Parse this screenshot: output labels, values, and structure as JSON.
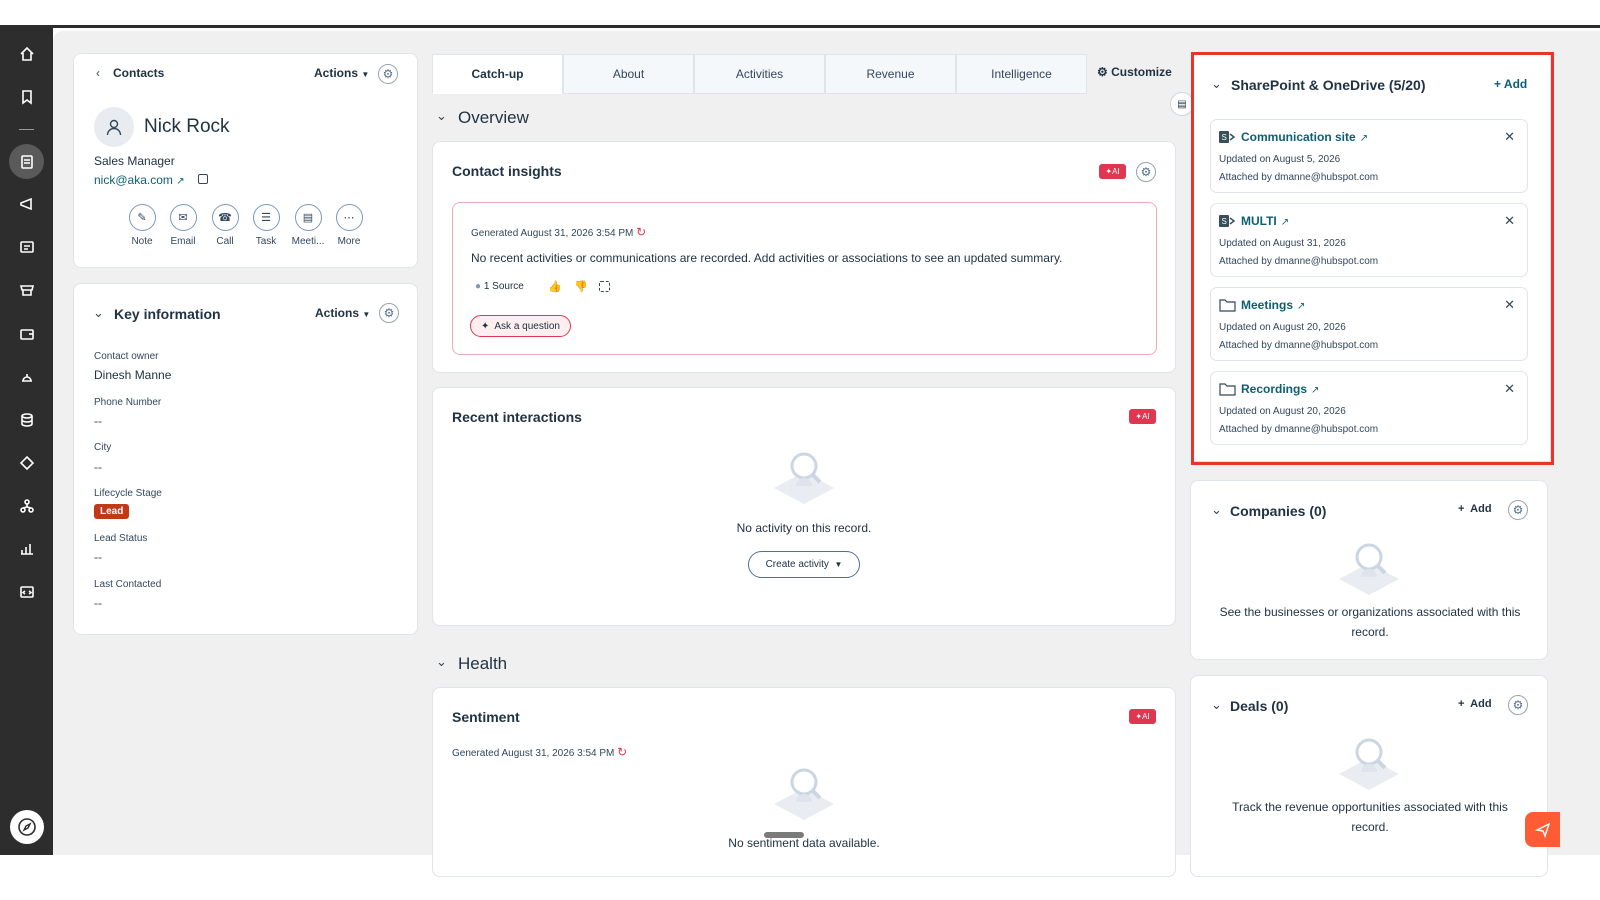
{
  "contact": {
    "back_label": "Contacts",
    "actions_label": "Actions",
    "name": "Nick Rock",
    "job_title": "Sales Manager",
    "email": "nick@aka.com",
    "actions": [
      {
        "label": "Note",
        "icon": "note-icon"
      },
      {
        "label": "Email",
        "icon": "email-icon"
      },
      {
        "label": "Call",
        "icon": "call-icon"
      },
      {
        "label": "Task",
        "icon": "task-icon"
      },
      {
        "label": "Meeti...",
        "icon": "meeting-icon"
      },
      {
        "label": "More",
        "icon": "more-icon"
      }
    ]
  },
  "key_info": {
    "title": "Key information",
    "actions_label": "Actions",
    "fields": [
      {
        "label": "Contact owner",
        "value": "Dinesh Manne"
      },
      {
        "label": "Phone Number",
        "value": "--"
      },
      {
        "label": "City",
        "value": "--"
      },
      {
        "label": "Lifecycle Stage",
        "value": "Lead"
      },
      {
        "label": "Lead Status",
        "value": "--"
      },
      {
        "label": "Last Contacted",
        "value": "--"
      }
    ]
  },
  "tabs": [
    "Catch-up",
    "About",
    "Activities",
    "Revenue",
    "Intelligence"
  ],
  "customize_label": "Customize",
  "overview": {
    "title": "Overview",
    "insights": {
      "title": "Contact insights",
      "ai_badge": "AI",
      "generated": "Generated August 31, 2026 3:54 PM",
      "summary": "No recent activities or communications are recorded. Add activities or associations to see an updated summary.",
      "sources": "1 Source",
      "ask_label": "Ask a question"
    },
    "recent": {
      "title": "Recent interactions",
      "ai_badge": "AI",
      "empty": "No activity on this record.",
      "create_label": "Create activity"
    }
  },
  "health": {
    "title": "Health",
    "sentiment": {
      "title": "Sentiment",
      "ai_badge": "AI",
      "generated": "Generated August 31, 2026 3:54 PM",
      "empty": "No sentiment data available."
    }
  },
  "sharepoint": {
    "title": "SharePoint & OneDrive (5/20)",
    "add_label": "+ Add",
    "items": [
      {
        "name": "Communication site",
        "updated": "Updated on August 5, 2026",
        "attached": "Attached by dmanne@hubspot.com",
        "type": "sharepoint"
      },
      {
        "name": "MULTI",
        "updated": "Updated on August 31, 2026",
        "attached": "Attached by dmanne@hubspot.com",
        "type": "sharepoint"
      },
      {
        "name": "Meetings",
        "updated": "Updated on August 20, 2026",
        "attached": "Attached by dmanne@hubspot.com",
        "type": "folder"
      },
      {
        "name": "Recordings",
        "updated": "Updated on August 20, 2026",
        "attached": "Attached by dmanne@hubspot.com",
        "type": "folder"
      }
    ]
  },
  "companies": {
    "title": "Companies (0)",
    "add_label": "Add",
    "empty": "See the businesses or organizations associated with this record."
  },
  "deals": {
    "title": "Deals (0)",
    "add_label": "Add",
    "empty": "Track the revenue opportunities associated with this record."
  },
  "colors": {
    "accent": "#e0364f",
    "link": "#0b5f72",
    "highlight": "#e8352a",
    "lead_badge": "#c0391b",
    "nav_bg": "#2d2d2d"
  }
}
